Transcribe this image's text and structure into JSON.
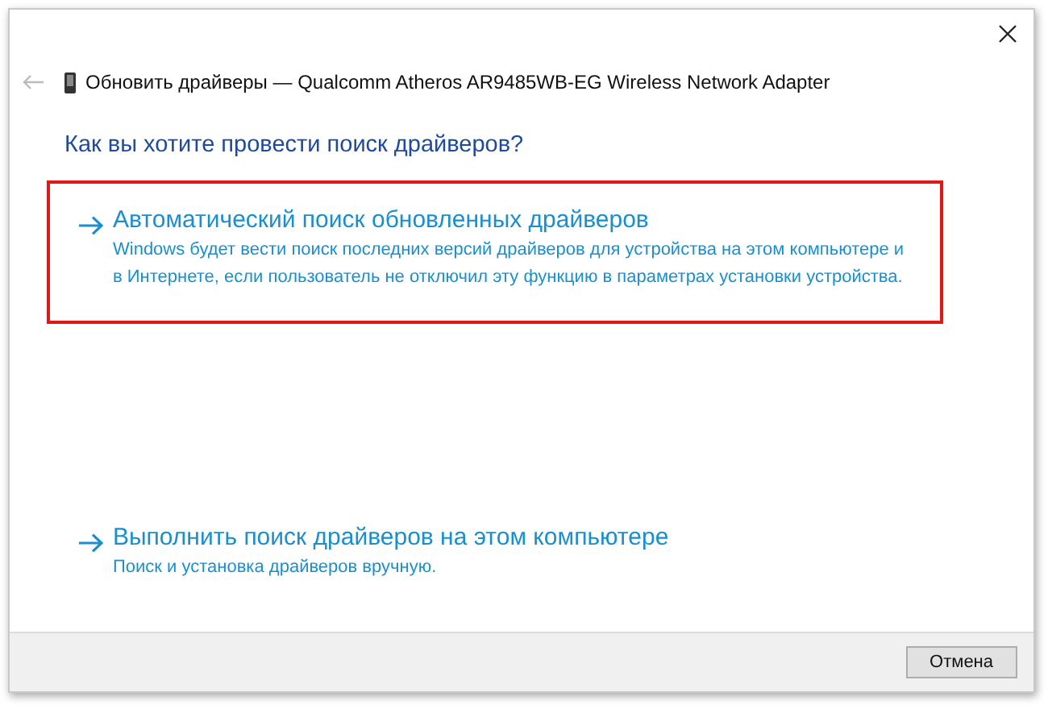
{
  "window": {
    "title": "Обновить драйверы — Qualcomm Atheros AR9485WB-EG Wireless Network Adapter"
  },
  "heading": "Как вы хотите провести поиск драйверов?",
  "options": [
    {
      "title": "Автоматический поиск обновленных драйверов",
      "description": "Windows будет вести поиск последних версий драйверов для устройства на этом компьютере и в Интернете, если пользователь не отключил эту функцию в параметрах установки устройства.",
      "highlighted": true
    },
    {
      "title": "Выполнить поиск драйверов на этом компьютере",
      "description": "Поиск и установка драйверов вручную.",
      "highlighted": false
    }
  ],
  "buttons": [
    "Отмена"
  ]
}
